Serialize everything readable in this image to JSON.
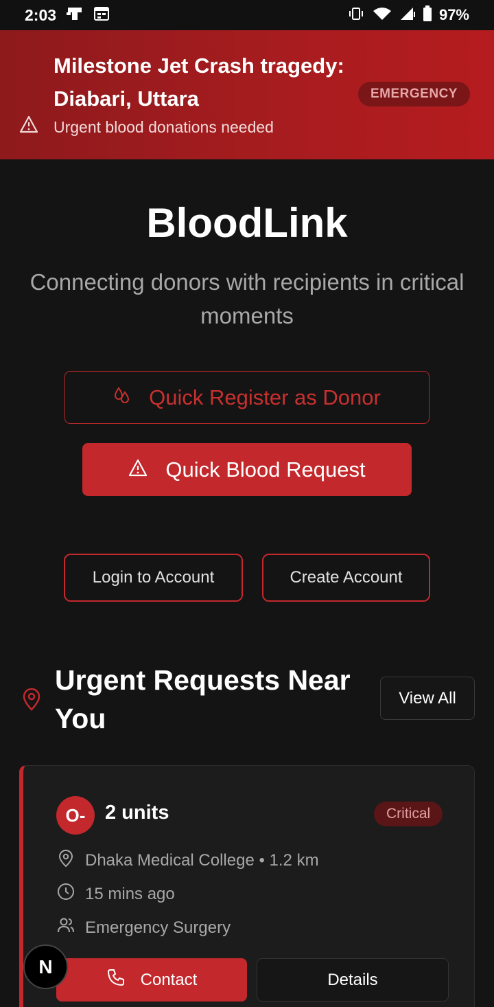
{
  "status_bar": {
    "time": "2:03",
    "battery": "97%"
  },
  "banner": {
    "title": "Milestone Jet Crash tragedy: Diabari, Uttara",
    "subtitle": "Urgent blood donations needed",
    "badge": "EMERGENCY"
  },
  "hero": {
    "title": "BloodLink",
    "tagline": "Connecting donors with recipients in critical moments"
  },
  "actions": {
    "register_label": "Quick Register as Donor",
    "request_label": "Quick Blood Request",
    "login_label": "Login to Account",
    "create_label": "Create Account"
  },
  "section": {
    "title": "Urgent Requests Near You",
    "view_all": "View All"
  },
  "request": {
    "blood_type": "O-",
    "units": "2 units",
    "severity": "Critical",
    "location": "Dhaka Medical College • 1.2 km",
    "time": "15 mins ago",
    "reason": "Emergency Surgery",
    "contact_label": "Contact",
    "details_label": "Details"
  },
  "dev_badge": {
    "letter": "N"
  },
  "colors": {
    "brand": "#c3282c",
    "background": "#141414",
    "card": "#1c1c1c"
  }
}
